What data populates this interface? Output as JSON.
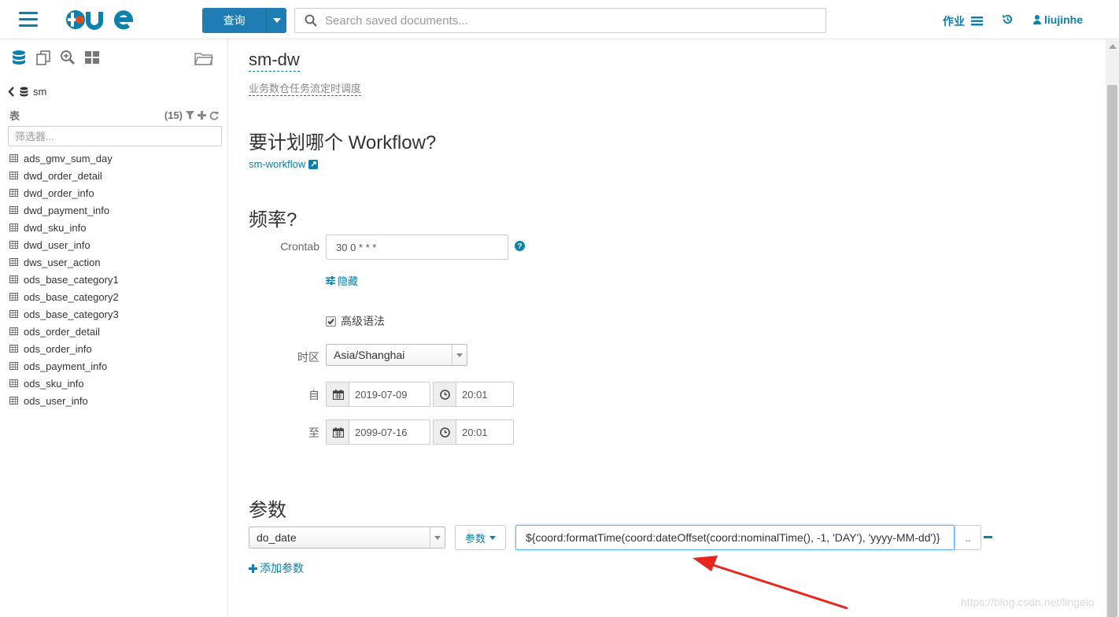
{
  "header": {
    "query_button": "查询",
    "search_placeholder": "Search saved documents...",
    "jobs_label": "作业",
    "username": "liujinhe"
  },
  "sidebar": {
    "database": "sm",
    "tables_label": "表",
    "tables_count": "(15)",
    "filter_placeholder": "筛选器...",
    "tables": [
      "ads_gmv_sum_day",
      "dwd_order_detail",
      "dwd_order_info",
      "dwd_payment_info",
      "dwd_sku_info",
      "dwd_user_info",
      "dws_user_action",
      "ods_base_category1",
      "ods_base_category2",
      "ods_base_category3",
      "ods_order_detail",
      "ods_order_info",
      "ods_payment_info",
      "ods_sku_info",
      "ods_user_info"
    ]
  },
  "coordinator": {
    "name": "sm-dw",
    "description": "业务数仓任务流定时调度",
    "workflow_heading": "要计划哪个 Workflow?",
    "workflow_link": "sm-workflow",
    "frequency_heading": "频率?",
    "crontab_label": "Crontab",
    "crontab_value": "30 0 * * *",
    "hide_link": "隐藏",
    "advanced_syntax_label": "高级语法",
    "advanced_syntax_checked": true,
    "timezone_label": "时区",
    "timezone_value": "Asia/Shanghai",
    "start_label": "自",
    "start_date": "2019-07-09",
    "start_time": "20:01",
    "end_label": "至",
    "end_date": "2099-07-16",
    "end_time": "20:01",
    "params_heading": "参数",
    "param_name": "do_date",
    "param_type_button": "参数",
    "param_value": "${coord:formatTime(coord:dateOffset(coord:nominalTime(), -1, 'DAY'), 'yyyy-MM-dd')}",
    "param_dots": "..",
    "add_param_link": "添加参数"
  },
  "watermark": "https://blog.csdn.net/lingeio",
  "colors": {
    "accent": "#0B7FAD",
    "primary_button": "#1F7DB3",
    "annotation_arrow": "#E8261E"
  }
}
